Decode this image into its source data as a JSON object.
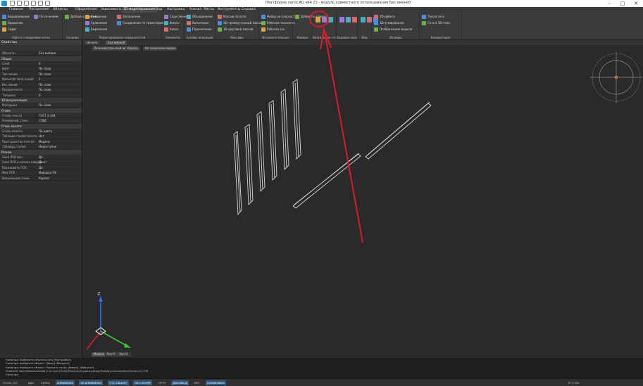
{
  "window": {
    "title": "Платформа nanoCAD x64 23 - модуль совместного использования Без имени0"
  },
  "menu": [
    {
      "label": "Главная"
    },
    {
      "label": "Построение"
    },
    {
      "label": "Объекты"
    },
    {
      "label": "Оформление"
    },
    {
      "label": "Зависимости"
    },
    {
      "label": "3D-моделирование",
      "active": true
    },
    {
      "label": "Вид"
    },
    {
      "label": "Настройка"
    },
    {
      "label": "Анализ"
    },
    {
      "label": "Листы"
    },
    {
      "label": "Инструменты"
    },
    {
      "label": "Справка"
    }
  ],
  "ribbon": {
    "groups": [
      {
        "label": "Работа с моделями сетки",
        "buttons": [
          "Выдавливание",
          "Вращение",
          "Сдвиг",
          "По сечениям"
        ]
      },
      {
        "label": "Сечение",
        "buttons": [
          "Добавить сечение"
        ]
      },
      {
        "label": "Редактирование поверхностей",
        "buttons": [
          "Смещение",
          "Удлинение",
          "Вырезание",
          "Заполнение",
          "Соединение по траектории"
        ]
      },
      {
        "label": "Элементы",
        "buttons": [
          "Скругление",
          "Фаска",
          "Уклон"
        ]
      },
      {
        "label": "Булевы операции",
        "buttons": [
          "Объединение",
          "Вычитание",
          "Пересечение"
        ]
      },
      {
        "label": "Массивы",
        "buttons": [
          "Массив по пути",
          "3D-прямоугольный массив",
          "3D-круговой массив"
        ]
      },
      {
        "label": "Вспомогательные",
        "buttons": [
          "Набор на плоскость",
          "Рабочая плоскость",
          "Рабочая ось"
        ]
      },
      {
        "label": "Камера",
        "buttons": [
          "Добавить камеру"
        ]
      },
      {
        "label": "Визуальные стили",
        "buttons": []
      },
      {
        "label": "Видовые экраны",
        "buttons": []
      },
      {
        "label": "Вид",
        "buttons": []
      },
      {
        "label": "3D-виды",
        "buttons": [
          "3D-орбита",
          "3D-зумирование",
          "Отображение модели"
        ]
      },
      {
        "label": "Конвертация",
        "buttons": [
          "Тело в сеть",
          "Сеть в 3D-тело"
        ]
      }
    ]
  },
  "properties": {
    "header": "Свойства",
    "object": {
      "label": "Объекты",
      "value": "Без выбора"
    },
    "sections": [
      {
        "title": "Общие",
        "rows": [
          {
            "k": "Слой",
            "v": "0"
          },
          {
            "k": "Цвет",
            "v": "По слою"
          },
          {
            "k": "Тип линий",
            "v": "По слою"
          },
          {
            "k": "Масштаб типа линий",
            "v": "1"
          },
          {
            "k": "Вес линий",
            "v": "По слою"
          },
          {
            "k": "Прозрачность",
            "v": "По слою"
          },
          {
            "k": "Толщина",
            "v": "0"
          }
        ]
      },
      {
        "title": "3D визуализация",
        "rows": [
          {
            "k": "Материал",
            "v": "По слою"
          }
        ]
      },
      {
        "title": "Стили",
        "rows": [
          {
            "k": "Стиль текста",
            "v": "ГОСТ 2.304"
          },
          {
            "k": "Размерный стиль",
            "v": "СПДС"
          }
        ]
      },
      {
        "title": "Стиль печати",
        "rows": [
          {
            "k": "Стиль печати",
            "v": "По цвету"
          },
          {
            "k": "Таблица стилей печати",
            "v": "Нет"
          },
          {
            "k": "Пространство печати",
            "v": "Модель"
          },
          {
            "k": "Таблица стилей",
            "v": "Недоступно"
          }
        ]
      },
      {
        "title": "Разное",
        "rows": [
          {
            "k": "Знак ПСК вкл.",
            "v": "Да"
          },
          {
            "k": "Знак ПСК в начале координат",
            "v": "Да"
          },
          {
            "k": "Показывать ПСК",
            "v": "Да"
          },
          {
            "k": "Имя ПСК",
            "v": "Мировая СК"
          },
          {
            "k": "Визуальный стиль",
            "v": "Каркас"
          }
        ]
      }
    ]
  },
  "doc_tabs": [
    "Начало",
    "Без имени0"
  ],
  "breadcrumbs": [
    "Пользовательский вид",
    "Каркас",
    "Не сохранено видов"
  ],
  "layout_tabs": [
    "Модель",
    "Лист1",
    "Лист2"
  ],
  "ucs": {
    "z_label": "Z"
  },
  "command_lines": [
    "Команда: Выберите объекты или [Настройки]:",
    "Команда: выберите объект: [Ввод] (Введите)",
    "Команда: выберите объект: Укажите точку [Вверх]: (Введите)",
    "Укажите противоположный угол или [Окно/Рамка/Секущая рамка/Прямоугольник/Все/Полигон]: Р/В",
    "Команда:"
  ],
  "status": [
    {
      "label": "25190,,0,0",
      "on": false
    },
    {
      "label": "ШАГ",
      "on": false
    },
    {
      "label": "СЕТКА",
      "on": false
    },
    {
      "label": "оПРИВЯЗКА",
      "on": true
    },
    {
      "label": "3D оПРИВЯЗКА",
      "on": true
    },
    {
      "label": "ОТС-ОБЪЕКТ",
      "on": true
    },
    {
      "label": "ОТС-ПОЛЯР",
      "on": true
    },
    {
      "label": "ОРТО",
      "on": false
    },
    {
      "label": "ДИН-ВВОД",
      "on": true
    },
    {
      "label": "ВЕС",
      "on": false
    },
    {
      "label": "ШТРИХОВКА",
      "on": true
    }
  ],
  "status_right": {
    "scale": "М 1:100"
  },
  "colors": {
    "accent": "#1f8fd6",
    "annotation": "#e0182c",
    "x_axis": "#3cc43c",
    "y_axis": "#2f70e6",
    "status_on": "#315a7e"
  }
}
